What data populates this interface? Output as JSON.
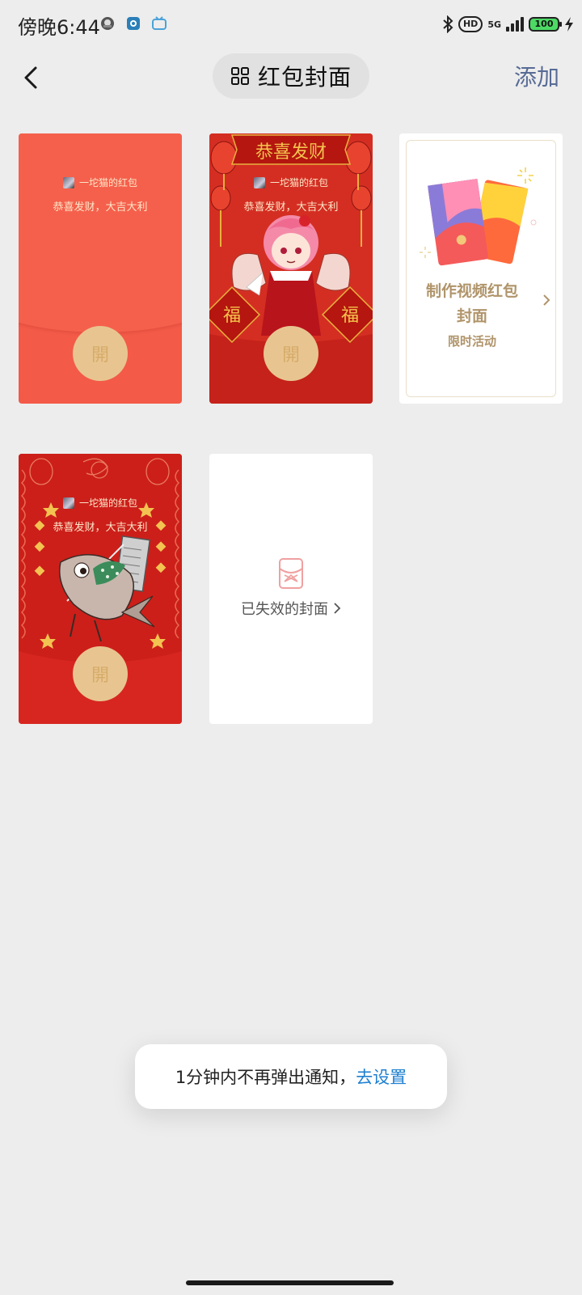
{
  "status_bar": {
    "time": "傍晚6:44",
    "notification_icons": [
      "avatar-app-icon",
      "camera-app-icon",
      "tv-app-icon"
    ],
    "hd_label": "HD",
    "network": "5G",
    "battery": "100",
    "icons": [
      "bluetooth-icon",
      "signal-icon",
      "charging-icon"
    ]
  },
  "nav": {
    "back_icon": "chevron-left-icon",
    "title_icon": "grid-icon",
    "title": "红包封面",
    "add_label": "添加"
  },
  "covers": [
    {
      "type": "envelope",
      "style": "plain-red",
      "sender": "一坨猫的红包",
      "wish": "恭喜发财，大吉大利",
      "open_glyph": "開"
    },
    {
      "type": "envelope",
      "style": "anime-girl-lanterns",
      "banner": "恭喜发财",
      "sender": "一坨猫的红包",
      "wish": "恭喜发财，大吉大利",
      "open_glyph": "開"
    },
    {
      "type": "promo",
      "title": "制作视频红包封面",
      "subtitle": "限时活动"
    },
    {
      "type": "envelope",
      "style": "fish-character",
      "sender": "一坨猫的红包",
      "wish": "恭喜发财，大吉大利",
      "open_glyph": "開"
    },
    {
      "type": "expired",
      "label": "已失效的封面"
    }
  ],
  "toast": {
    "message": "1分钟内不再弹出通知，",
    "link": "去设置"
  },
  "colors": {
    "envelope_red": "#f35a48",
    "gold": "#e8c590",
    "link_blue": "#1e7fd0",
    "nav_link": "#576b95"
  }
}
